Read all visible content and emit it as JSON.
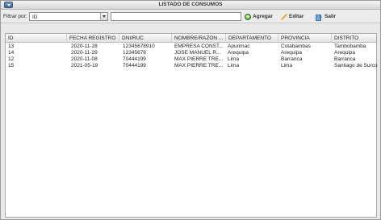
{
  "window": {
    "title": "LISTADO DE CONSUMOS"
  },
  "toolbar": {
    "filter_label": "Filtrar por:",
    "filter_value": "ID",
    "search_value": "",
    "add_label": "Agregar",
    "edit_label": "Editar",
    "exit_label": "Salir"
  },
  "table": {
    "columns": [
      "ID",
      "FECHA REGISTRO",
      "DNI/RUC",
      "NOMBRE/RAZON ...",
      "DEPARTAMENTO",
      "PROVINCIA",
      "DISTRITO"
    ],
    "rows": [
      [
        "13",
        "2020-11-28",
        "12345678910",
        "EMPRESA CONST...",
        "Apurimac",
        "Cotabambas",
        "Tambobamba"
      ],
      [
        "14",
        "2020-11-29",
        "12345678",
        "JOSE MANUEL R...",
        "Arequipa",
        "Arequipa",
        "Arequipa"
      ],
      [
        "12",
        "2020-11-08",
        "70444199",
        "MAX PIERRE TRE...",
        "Lima",
        "Barranca",
        "Barranca"
      ],
      [
        "15",
        "2021-05-19",
        "70444199",
        "MAX PIERRE TRE...",
        "Lima",
        "Lima",
        "Santiago de Surco"
      ]
    ]
  }
}
